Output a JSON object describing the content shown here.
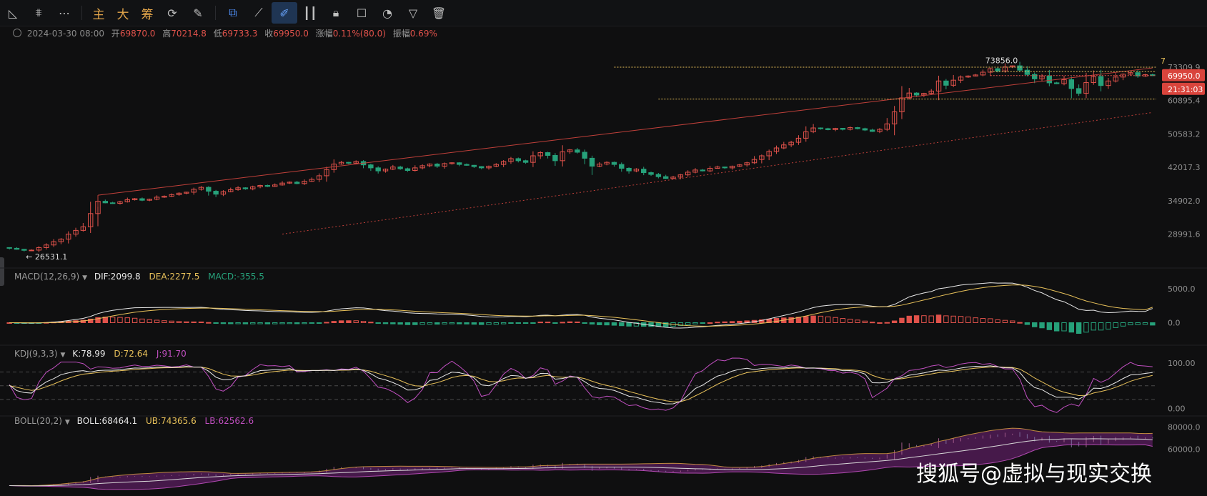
{
  "toolbar": {
    "items": [
      {
        "name": "trend-line-icon",
        "glyph": "◺"
      },
      {
        "name": "indicator-icon",
        "glyph": "⩨"
      },
      {
        "name": "more-icon",
        "glyph": "⋯"
      },
      {
        "name": "sep"
      },
      {
        "name": "main-chart-button",
        "text": "主"
      },
      {
        "name": "big-order-button",
        "text": "大"
      },
      {
        "name": "chips-button",
        "text": "筹"
      },
      {
        "name": "refresh-icon",
        "glyph": "⟳"
      },
      {
        "name": "brush-icon",
        "glyph": "✎"
      },
      {
        "name": "sep"
      },
      {
        "name": "layers-icon",
        "glyph": "⧉",
        "blue": true
      },
      {
        "name": "ruler-icon",
        "glyph": "⟋"
      },
      {
        "name": "draw-icon",
        "glyph": "✐",
        "active": true
      },
      {
        "name": "candles-icon",
        "glyph": "┃┃"
      },
      {
        "name": "lock-icon",
        "glyph": "🔒︎"
      },
      {
        "name": "note-icon",
        "glyph": "☐"
      },
      {
        "name": "magnet-icon",
        "glyph": "◔"
      },
      {
        "name": "filter-icon",
        "glyph": "▽"
      },
      {
        "name": "trash-icon",
        "glyph": "🗑︎"
      }
    ]
  },
  "ohlc": {
    "date": "2024-03-30 08:00",
    "open_label": "开",
    "open": "69870.0",
    "high_label": "高",
    "high": "70214.8",
    "low_label": "低",
    "low": "69733.3",
    "close_label": "收",
    "close": "69950.0",
    "change_label": "涨幅",
    "change": "0.11%(80.0)",
    "amp_label": "振幅",
    "amp": "0.69%"
  },
  "macd_label": {
    "name": "MACD(12,26,9)",
    "dif": "DIF:2099.8",
    "dea": "DEA:2277.5",
    "macd": "MACD:-355.5"
  },
  "kdj_label": {
    "name": "KDJ(9,3,3)",
    "k": "K:78.99",
    "d": "D:72.64",
    "j": "J:91.70"
  },
  "boll_label": {
    "name": "BOLL(20,2)",
    "boll": "BOLL:68464.1",
    "ub": "UB:74365.6",
    "lb": "LB:62562.6"
  },
  "colors": {
    "up": "#e0524b",
    "down": "#26a17a",
    "dif": "#e8e8e8",
    "dea": "#e8c15a",
    "j": "#c04fc0",
    "grid": "#1b1c1f"
  },
  "chart_data": [
    {
      "type": "candlestick",
      "panel": "price",
      "y_scale": "log",
      "y_ticks": [
        "73309.9",
        "60895.4",
        "50583.2",
        "42017.3",
        "34902.0",
        "28991.6"
      ],
      "y_tick_values": [
        73309.9,
        60895.4,
        50583.2,
        42017.3,
        34902.0,
        28991.6
      ],
      "ylim": [
        24500,
        80000
      ],
      "last_price": "69950.0",
      "countdown": "21:31:03",
      "high_annotation": "73856.0",
      "low_annotation": "26531.1",
      "right_marker": "7",
      "close": [
        26800,
        26650,
        26500,
        26531,
        26900,
        27300,
        27800,
        28200,
        29000,
        29600,
        30200,
        32500,
        34800,
        34500,
        34400,
        34700,
        35100,
        35300,
        35000,
        35200,
        35600,
        35800,
        36100,
        36400,
        36600,
        37200,
        37600,
        36800,
        36200,
        36700,
        37100,
        37500,
        37300,
        37700,
        38000,
        37800,
        38100,
        38500,
        38700,
        38400,
        38900,
        39300,
        40100,
        41500,
        42800,
        43200,
        43000,
        43400,
        42600,
        41900,
        41200,
        41600,
        42100,
        41700,
        41300,
        41900,
        42400,
        42800,
        42300,
        42900,
        43100,
        42700,
        42500,
        42200,
        41900,
        42300,
        42700,
        43400,
        44100,
        43600,
        43200,
        44800,
        45600,
        44900,
        43600,
        45800,
        46300,
        45700,
        44200,
        42300,
        42800,
        43200,
        42700,
        41800,
        41200,
        41600,
        40800,
        40400,
        39900,
        39500,
        39800,
        40300,
        40900,
        41400,
        41200,
        41800,
        42100,
        41900,
        42300,
        42600,
        43100,
        43900,
        44800,
        45900,
        46800,
        47600,
        48300,
        49400,
        51200,
        52300,
        52100,
        51800,
        52200,
        51900,
        52400,
        52100,
        51700,
        51300,
        51900,
        53500,
        57200,
        61800,
        63500,
        62800,
        63400,
        64200,
        67900,
        66300,
        68200,
        69400,
        69800,
        70200,
        71300,
        72700,
        71800,
        73400,
        73856,
        72100,
        70400,
        68700,
        69800,
        67200,
        66900,
        68400,
        65100,
        63400,
        67300,
        69600,
        66200,
        67900,
        69400,
        70500,
        71100,
        69800,
        70300,
        69950
      ],
      "trend_line": [
        [
          12,
          36000
        ],
        [
          155,
          73000
        ]
      ],
      "dotted_trend_line": [
        [
          37,
          29000
        ],
        [
          155,
          57000
        ]
      ],
      "levels": [
        73309.9,
        61400
      ]
    },
    {
      "type": "macd",
      "panel": "macd",
      "y_ticks": [
        "5000.0",
        "0.0"
      ],
      "y_tick_values": [
        5000,
        0
      ],
      "ylim": [
        -3000,
        7000
      ],
      "label": "MACD(12,26,9)",
      "dif": 2099.8,
      "dea": 2277.5,
      "macd": -355.5
    },
    {
      "type": "kdj",
      "panel": "kdj",
      "y_ticks": [
        "100.00",
        "0.00"
      ],
      "y_tick_values": [
        100,
        0
      ],
      "ylim": [
        -10,
        120
      ],
      "label": "KDJ(9,3,3)",
      "k": 78.99,
      "d": 72.64,
      "j": 91.7
    },
    {
      "type": "boll",
      "panel": "boll",
      "y_ticks": [
        "80000.0",
        "60000.0"
      ],
      "y_tick_values": [
        80000,
        60000
      ],
      "ylim": [
        20000,
        85000
      ],
      "label": "BOLL(20,2)",
      "boll": 68464.1,
      "ub": 74365.6,
      "lb": 62562.6
    }
  ],
  "watermark": "搜狐号@虚拟与现实交换"
}
